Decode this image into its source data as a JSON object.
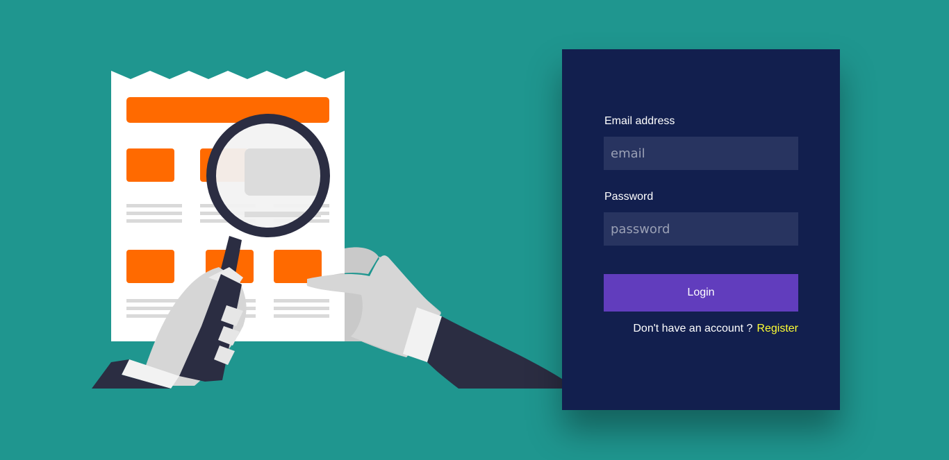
{
  "login_form": {
    "email_label": "Email address",
    "email_placeholder": "email",
    "email_value": "",
    "password_label": "Password",
    "password_placeholder": "password",
    "password_value": "",
    "login_button_label": "Login",
    "register_prompt": "Don't have an account ?",
    "register_link_label": "Register"
  },
  "colors": {
    "page_background": "#1f968f",
    "card_background": "#121f4e",
    "input_background": "#283460",
    "button_background": "#613dbd",
    "register_link": "#ffff33",
    "accent_orange": "#ff6a00"
  },
  "illustration": {
    "icon": "document-with-magnifying-glass-illustration"
  }
}
